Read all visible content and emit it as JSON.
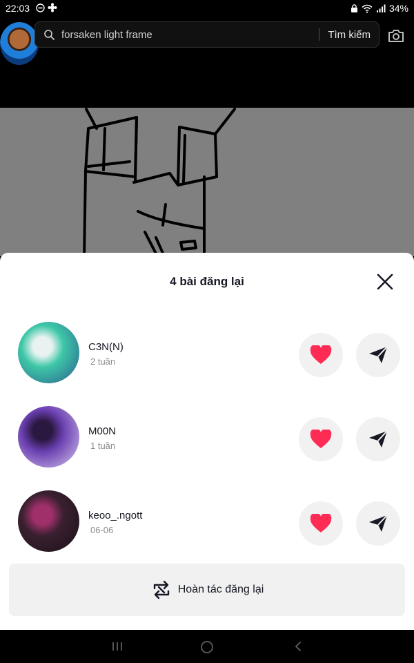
{
  "status_bar": {
    "time": "22:03",
    "battery": "34%",
    "left_icons": [
      "do-not-disturb-icon",
      "settings-flower-icon"
    ],
    "right_icons": [
      "lock-icon",
      "wifi-icon",
      "signal-icon"
    ]
  },
  "search": {
    "query": "forsaken light frame",
    "button_label": "Tìm kiếm",
    "icon": "search-icon",
    "camera_icon": "camera-icon"
  },
  "sheet": {
    "title": "4 bài đăng lại",
    "close_icon": "close-icon",
    "items": [
      {
        "name": "C3N(N)",
        "time": "2 tuần",
        "avatar_colors": [
          "#3ec7a8",
          "#e9f2f0",
          "#2a5c8c"
        ]
      },
      {
        "name": "M00N",
        "time": "1 tuần",
        "avatar_colors": [
          "#6a3fb0",
          "#2a1840",
          "#d8c8f0"
        ]
      },
      {
        "name": "keoo_.ngott",
        "time": "06-06",
        "avatar_colors": [
          "#3a2030",
          "#a0306a",
          "#1a1018"
        ]
      }
    ],
    "undo_label": "Hoàn tác đăng lại",
    "undo_icon": "repost-undo-icon"
  },
  "colors": {
    "like": "#fe2c55",
    "text_primary": "#161823",
    "text_secondary": "#8a8b91",
    "button_bg": "#f1f1f2"
  },
  "nav": [
    "recents-icon",
    "home-icon",
    "back-icon"
  ]
}
